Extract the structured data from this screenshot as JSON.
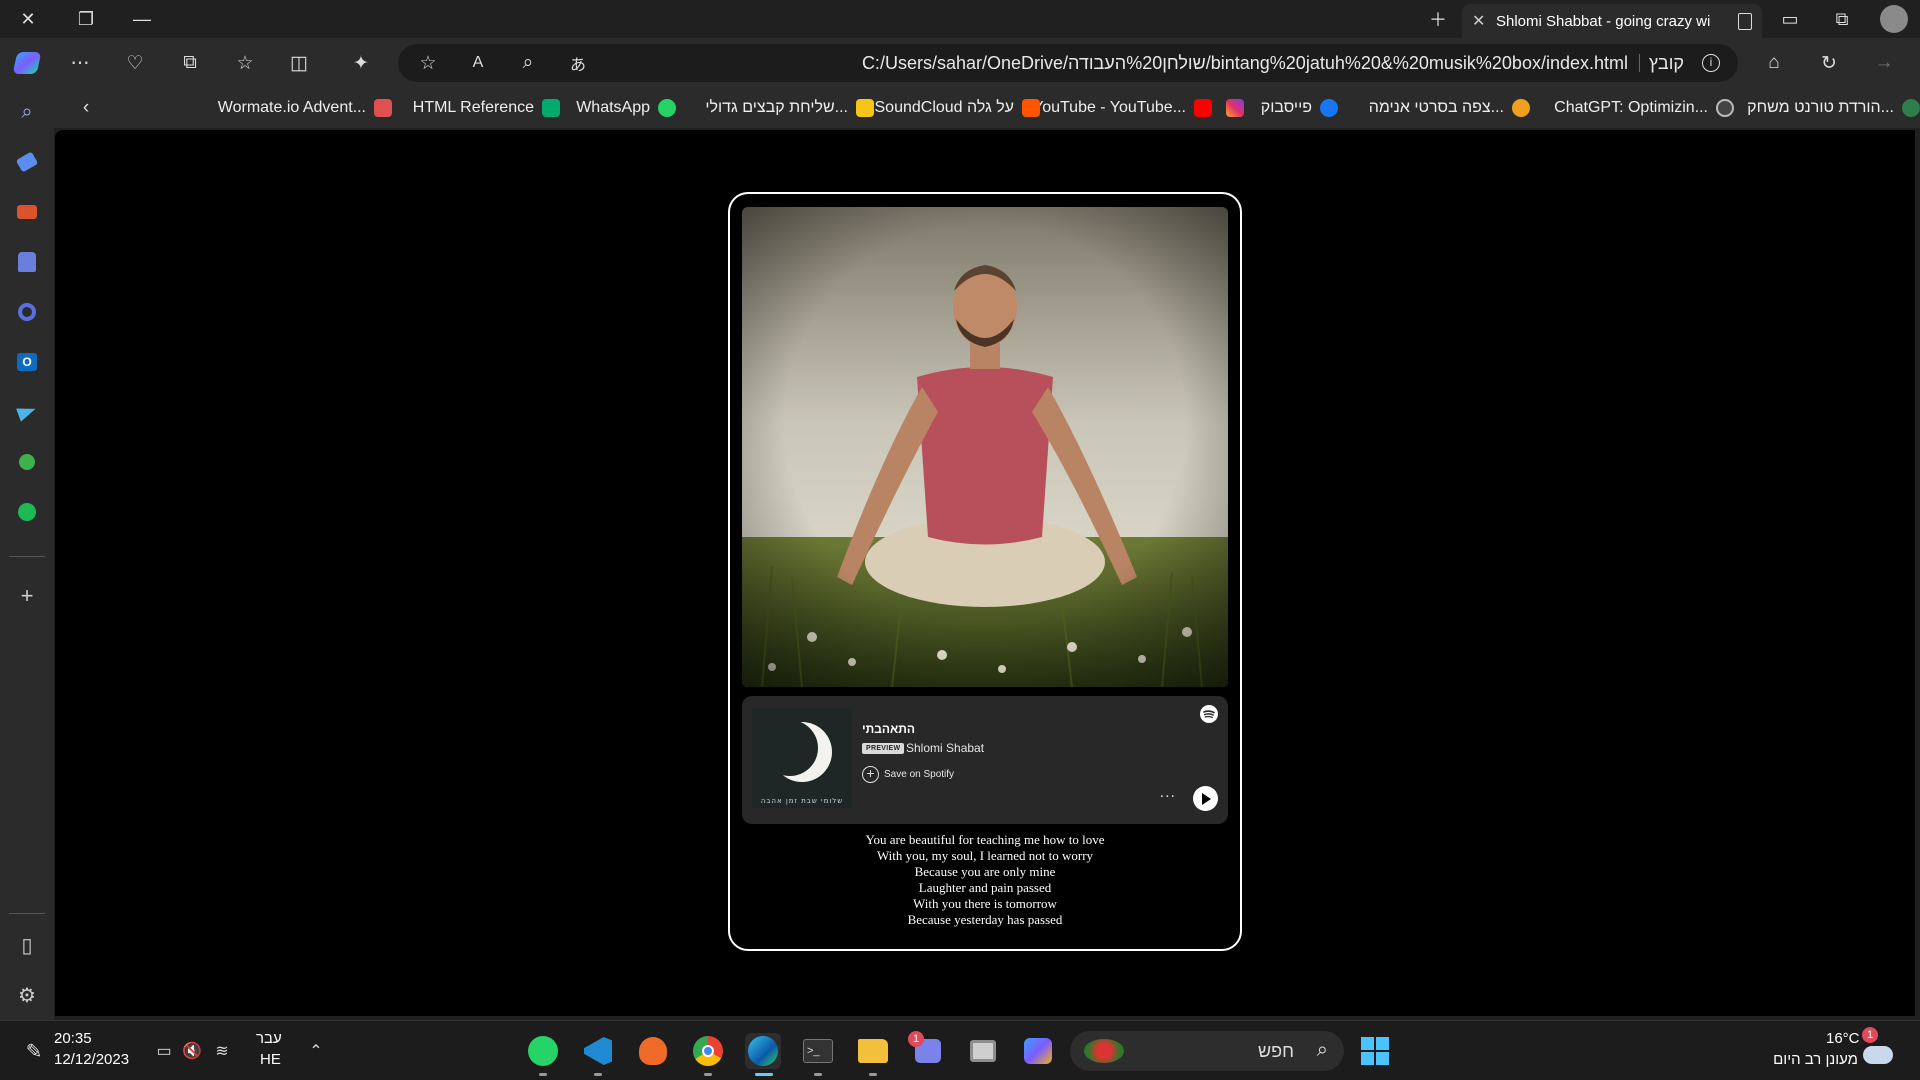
{
  "browser": {
    "tab_title": "Shlomi Shabbat - going crazy wi",
    "url": "C:/Users/sahar/OneDrive/שולחן%20העבודה/bintang%20jatuh%20&%20musik%20box/index.html",
    "url_label": "קובץ"
  },
  "favorites": [
    {
      "label": "הורדת טורנט משחק...",
      "color": "#2f7d4a"
    },
    {
      "label": "ChatGPT: Optimizin...",
      "color": "#444444"
    },
    {
      "label": "צפה בסרטי אנימה...",
      "color": "#f0a020"
    },
    {
      "label": "פייסבוק",
      "color": "#1877f2"
    },
    {
      "label": "",
      "color": "#e1306c"
    },
    {
      "label": "YouTube - YouTube...",
      "color": "#ff0000"
    },
    {
      "label": "SoundCloud על גלה",
      "color": "#ff5500"
    },
    {
      "label": "שליחת קבצים גדולי...",
      "color": "#f5c518"
    },
    {
      "label": "WhatsApp",
      "color": "#25d366"
    },
    {
      "label": "HTML Reference",
      "color": "#04aa6d"
    },
    {
      "label": "Wormate.io Advent...",
      "color": "#e05050"
    }
  ],
  "player": {
    "track_title": "התאהבתי",
    "preview_label": "PREVIEW",
    "artist": "Shlomi Shabat",
    "save_label": "Save on Spotify",
    "more_label": "...",
    "cover_caption": "שלומי שבת זמן אהבה"
  },
  "lyrics": [
    "You are beautiful for teaching me how to love",
    "With you, my soul, I learned not to worry",
    "Because you are only mine",
    "Laughter and pain passed",
    "With you there is tomorrow",
    "Because yesterday has passed"
  ],
  "taskbar": {
    "time": "20:35",
    "date": "12/12/2023",
    "lang_top": "עבר",
    "lang_bottom": "HE",
    "search_placeholder": "חפש",
    "weather_temp": "16°C",
    "weather_desc": "מעונן רב היום",
    "chat_badge": "1",
    "weather_badge": "1"
  }
}
